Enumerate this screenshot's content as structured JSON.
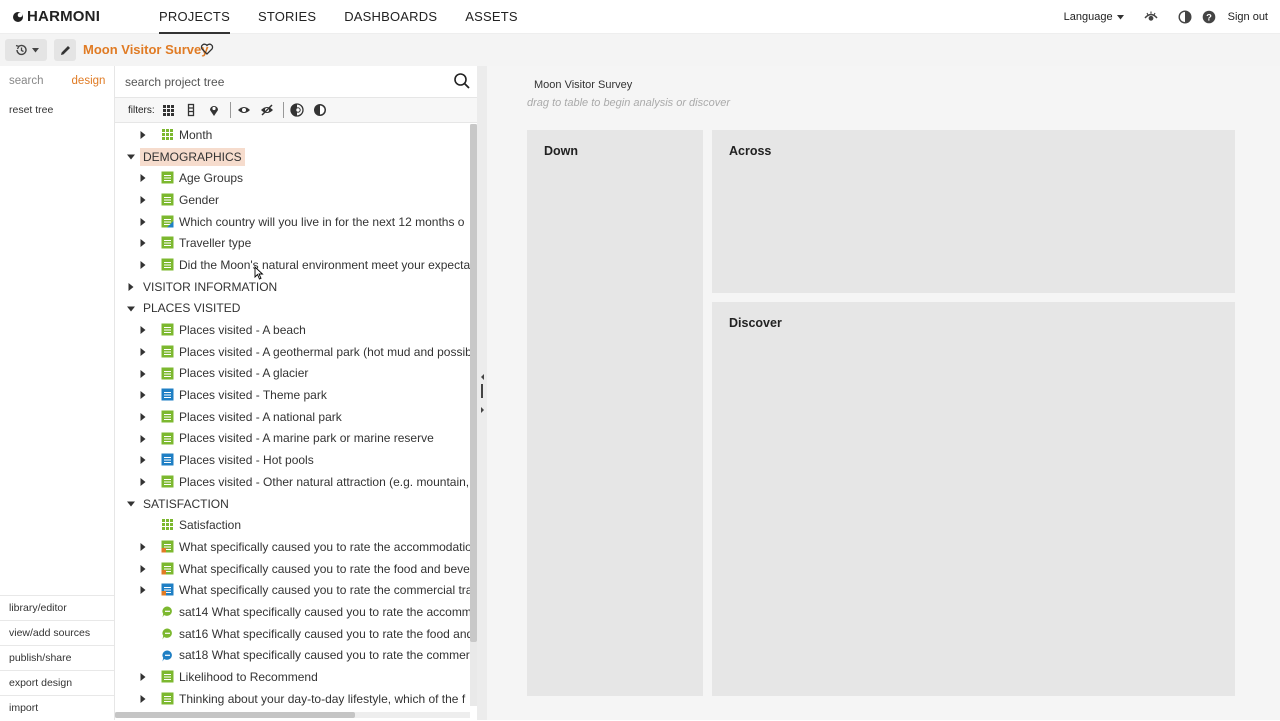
{
  "app": {
    "logo_text": "HARMONI"
  },
  "nav": [
    {
      "label": "PROJECTS",
      "active": true
    },
    {
      "label": "STORIES",
      "active": false
    },
    {
      "label": "DASHBOARDS",
      "active": false
    },
    {
      "label": "ASSETS",
      "active": false
    }
  ],
  "topright": {
    "language_label": "Language",
    "signout_label": "Sign out"
  },
  "project": {
    "title": "Moon Visitor Survey"
  },
  "sidebar": {
    "tabs": [
      {
        "label": "search",
        "active": false
      },
      {
        "label": "design",
        "active": true
      }
    ],
    "reset_tree": "reset tree",
    "links": [
      "library/editor",
      "view/add sources",
      "publish/share",
      "export design",
      "import"
    ]
  },
  "tree_panel": {
    "search_placeholder": "search project tree",
    "filters_label": "filters:",
    "rows": [
      {
        "kind": "var",
        "level": 1,
        "caret": "right",
        "icon": "grid",
        "label": "Month"
      },
      {
        "kind": "folder",
        "level": 0,
        "caret": "down",
        "label": "DEMOGRAPHICS",
        "highlight": true
      },
      {
        "kind": "var",
        "level": 1,
        "caret": "right",
        "icon": "green",
        "label": "Age Groups"
      },
      {
        "kind": "var",
        "level": 1,
        "caret": "right",
        "icon": "green",
        "label": "Gender"
      },
      {
        "kind": "var",
        "level": 1,
        "caret": "right",
        "icon": "green-blue",
        "label": "Which country will you live in for the next 12 months o"
      },
      {
        "kind": "var",
        "level": 1,
        "caret": "right",
        "icon": "green",
        "label": "Traveller type"
      },
      {
        "kind": "var",
        "level": 1,
        "caret": "right",
        "icon": "green",
        "label": "Did the Moon's natural environment meet your expecta"
      },
      {
        "kind": "folder",
        "level": 0,
        "caret": "right",
        "label": "VISITOR INFORMATION",
        "highlight": false
      },
      {
        "kind": "folder",
        "level": 0,
        "caret": "down",
        "label": "PLACES VISITED",
        "highlight": false
      },
      {
        "kind": "var",
        "level": 1,
        "caret": "right",
        "icon": "green",
        "label": "Places visited - A beach"
      },
      {
        "kind": "var",
        "level": 1,
        "caret": "right",
        "icon": "green",
        "label": "Places visited - A geothermal park (hot mud and possib"
      },
      {
        "kind": "var",
        "level": 1,
        "caret": "right",
        "icon": "green",
        "label": "Places visited - A glacier"
      },
      {
        "kind": "var",
        "level": 1,
        "caret": "right",
        "icon": "blue",
        "label": "Places visited - Theme park"
      },
      {
        "kind": "var",
        "level": 1,
        "caret": "right",
        "icon": "green",
        "label": "Places visited - A national park"
      },
      {
        "kind": "var",
        "level": 1,
        "caret": "right",
        "icon": "green",
        "label": "Places visited - A marine park or marine reserve"
      },
      {
        "kind": "var",
        "level": 1,
        "caret": "right",
        "icon": "blue",
        "label": "Places visited - Hot pools"
      },
      {
        "kind": "var",
        "level": 1,
        "caret": "right",
        "icon": "green",
        "label": "Places visited - Other natural attraction (e.g. mountain,"
      },
      {
        "kind": "folder",
        "level": 0,
        "caret": "down",
        "label": "SATISFACTION",
        "highlight": false
      },
      {
        "kind": "var",
        "level": 1,
        "caret": "none",
        "icon": "grid",
        "label": "Satisfaction"
      },
      {
        "kind": "var",
        "level": 1,
        "caret": "right",
        "icon": "green-orange",
        "label": "What specifically caused you to rate the accommodatio"
      },
      {
        "kind": "var",
        "level": 1,
        "caret": "right",
        "icon": "green-orange",
        "label": "What specifically caused you to rate the food and beve"
      },
      {
        "kind": "var",
        "level": 1,
        "caret": "right",
        "icon": "blue-orange",
        "label": "What specifically caused you to rate the commercial tra"
      },
      {
        "kind": "var",
        "level": 1,
        "caret": "none",
        "icon": "text-green",
        "label": "sat14 What specifically caused you to rate the accomm"
      },
      {
        "kind": "var",
        "level": 1,
        "caret": "none",
        "icon": "text-green",
        "label": "sat16 What specifically caused you to rate the food and"
      },
      {
        "kind": "var",
        "level": 1,
        "caret": "none",
        "icon": "text-blue",
        "label": "sat18 What specifically caused you to rate the commer"
      },
      {
        "kind": "var",
        "level": 1,
        "caret": "right",
        "icon": "green",
        "label": "Likelihood to Recommend"
      },
      {
        "kind": "var",
        "level": 1,
        "caret": "right",
        "icon": "green",
        "label": "Thinking about your day-to-day lifestyle, which of the f"
      }
    ]
  },
  "workspace": {
    "title": "Moon Visitor Survey",
    "hint": "drag to table to begin analysis or discover",
    "zones": {
      "down": "Down",
      "across": "Across",
      "discover": "Discover"
    }
  },
  "colors": {
    "accent": "#e07b24",
    "green_icon": "#7cb82f",
    "blue_icon": "#1f7fc4",
    "orange_icon": "#e07b24"
  }
}
